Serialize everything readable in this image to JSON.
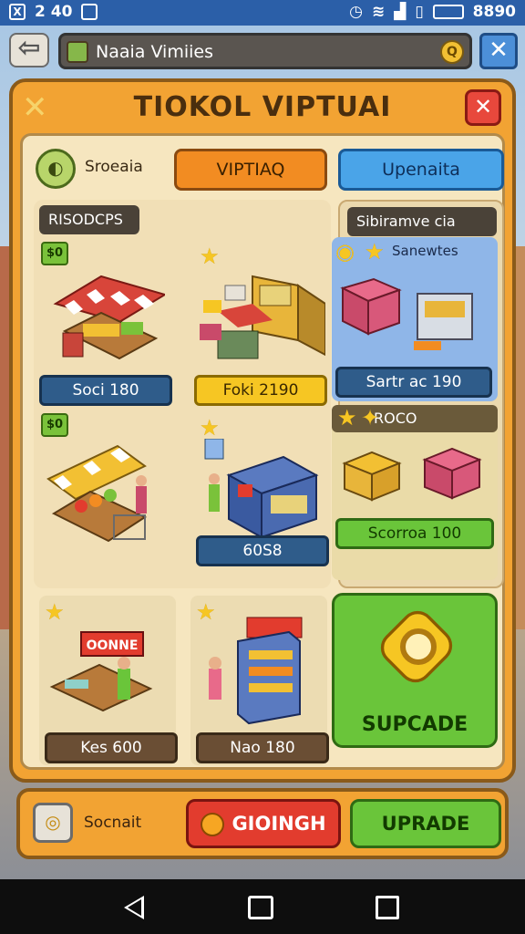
{
  "status_bar": {
    "left_icon_1": "X",
    "time": "2 40",
    "right_value": "8890",
    "icons": [
      "x-app-icon",
      "image-icon",
      "alarm-icon",
      "wifi-icon",
      "signal-icon",
      "vibrate-icon",
      "battery-icon"
    ]
  },
  "app_bar": {
    "search_text": "Naaia Vimiies",
    "search_icon": "search-icon",
    "search_glyph": "Q",
    "close_glyph": "✕"
  },
  "panel": {
    "title": "TIOKOL VIPTUAI",
    "close_glyph": "✕",
    "tab_caption": "Sroeaia",
    "tabs": [
      "VIPTIAQ",
      "Upenaita"
    ]
  },
  "sections": {
    "left_header": "RISODCPS",
    "right_header": "Sibiramve cia",
    "right_top_caption": "Sanewtes",
    "right_mid_caption": "ROCO"
  },
  "cards": [
    {
      "badge": "$0",
      "label": "Soci 180",
      "style": "blue"
    },
    {
      "badge": "",
      "label": "Foki 2190",
      "style": "yellow"
    },
    {
      "badge": "$0",
      "label": "",
      "style": "none"
    },
    {
      "badge": "",
      "label": "60S8",
      "style": "blue"
    },
    {
      "badge": "",
      "label": "Kes 600",
      "style": "brown"
    },
    {
      "badge": "",
      "label": "Nao 180",
      "style": "brown"
    }
  ],
  "right_cards": {
    "top_label": "Sartr ac 190",
    "mid_label": "Scorroa 100"
  },
  "sign_text": "OONNE",
  "upgrade_big": {
    "label": "SUPCADE"
  },
  "bottom_bar": {
    "text": "Socnait",
    "red_button": "GIOINGH",
    "green_button": "UPRADE"
  },
  "colors": {
    "panel_orange": "#f2a333",
    "tab_orange": "#f28c22",
    "tab_blue": "#4aa4e8",
    "accent_green": "#6ac53a",
    "accent_red": "#e23c2e",
    "status_blue": "#2b5fa8"
  }
}
